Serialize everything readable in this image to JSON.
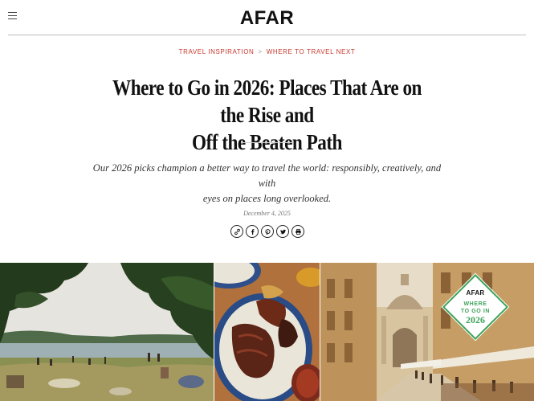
{
  "header": {
    "logo": "AFAR",
    "menu_icon": "hamburger-menu-icon"
  },
  "breadcrumb": {
    "items": [
      "TRAVEL INSPIRATION",
      "WHERE TO TRAVEL NEXT"
    ],
    "separator": ">"
  },
  "article": {
    "title_line1": "Where to Go in 2026: Places That Are on the Rise and",
    "title_line2": "Off the Beaten Path",
    "dek_line1": "Our 2026 picks champion a better way to travel the world: responsibly, creatively, and with",
    "dek_line2": "eyes on places long overlooked.",
    "date": "December 4, 2025"
  },
  "share": {
    "icons": [
      "link-icon",
      "facebook-icon",
      "pinterest-icon",
      "twitter-icon",
      "print-icon"
    ]
  },
  "badge": {
    "logo": "AFAR",
    "line1": "WHERE",
    "line2": "TO GO IN",
    "year": "2026"
  },
  "colors": {
    "accent_red": "#c8372d",
    "badge_green": "#3fa35a",
    "text": "#111111"
  }
}
